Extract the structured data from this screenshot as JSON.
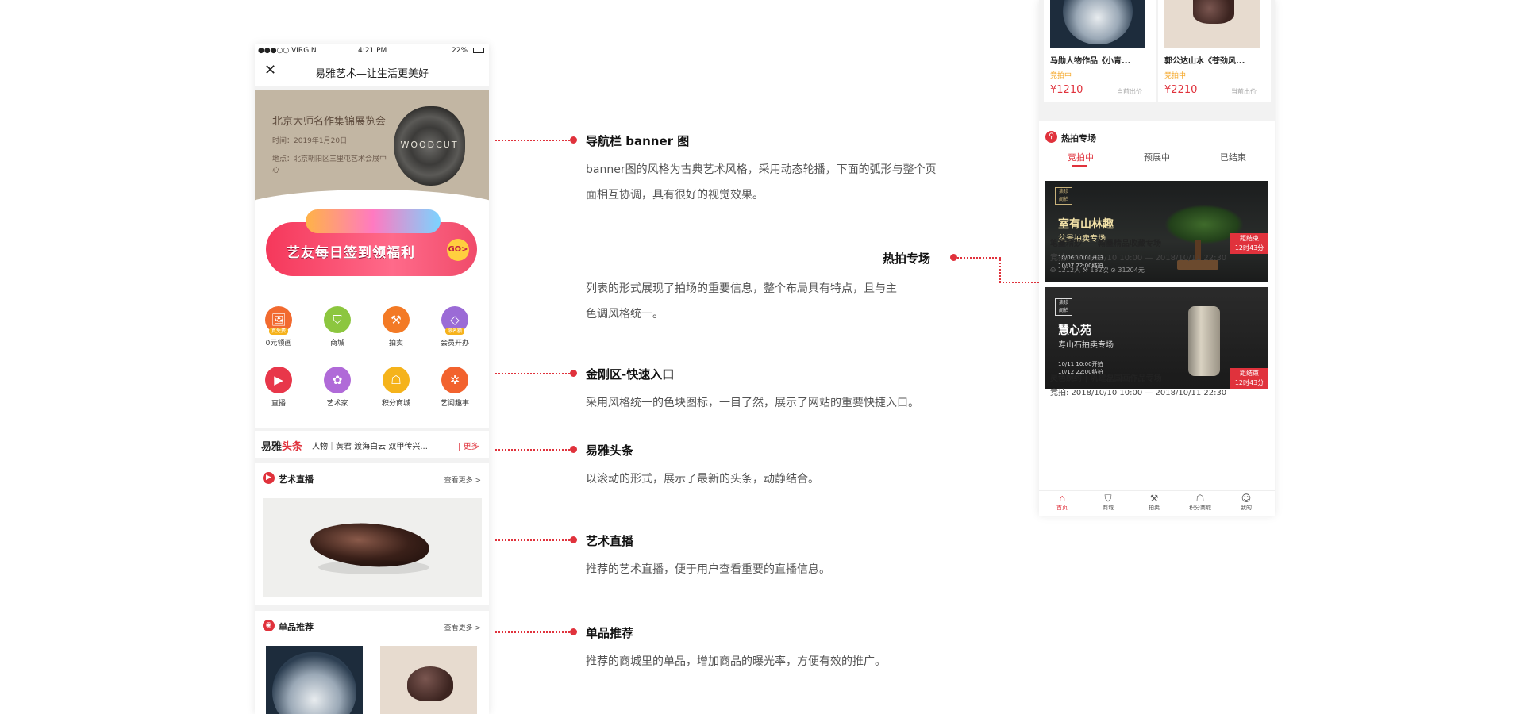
{
  "status": {
    "carrier": "●●●○○ VIRGIN",
    "time": "4:21 PM",
    "battery": "22%"
  },
  "nav": {
    "title": "易雅艺术—让生活更美好"
  },
  "banner": {
    "title": "北京大师名作集锦展览会",
    "time": "时间：2019年1月20日",
    "address": "地点：北京朝阳区三里屯艺术会展中心",
    "overlay": "WOODCUT"
  },
  "promo": {
    "text": "艺友每日签到领福利",
    "go": "GO>"
  },
  "grid": [
    {
      "label": "0元领画",
      "badge": "真免费",
      "color": "#f26a2f",
      "icon": "gift-icon",
      "glyph": "🖼"
    },
    {
      "label": "商城",
      "badge": "",
      "color": "#8cc63f",
      "icon": "bag-icon",
      "glyph": "⛉"
    },
    {
      "label": "拍卖",
      "badge": "",
      "color": "#f37a25",
      "icon": "gavel-icon",
      "glyph": "⚒"
    },
    {
      "label": "会员开办",
      "badge": "限名额",
      "color": "#9b6bd6",
      "icon": "diamond-icon",
      "glyph": "◇"
    },
    {
      "label": "直播",
      "badge": "",
      "color": "#e8374a",
      "icon": "tv-icon",
      "glyph": "▶"
    },
    {
      "label": "艺术家",
      "badge": "",
      "color": "#b06ad8",
      "icon": "palette-icon",
      "glyph": "✿"
    },
    {
      "label": "积分商城",
      "badge": "",
      "color": "#f5b31b",
      "icon": "basket-icon",
      "glyph": "☖"
    },
    {
      "label": "艺闻趣事",
      "badge": "",
      "color": "#f2622e",
      "icon": "pinwheel-icon",
      "glyph": "✲"
    }
  ],
  "headline": {
    "brand_black": "易雅",
    "brand_red": "头条",
    "text": "人物｜黄君   渡海白云  双甲传兴...",
    "more": "| 更多"
  },
  "live": {
    "title": "艺术直播",
    "more": "查看更多 >"
  },
  "single": {
    "title": "单品推荐",
    "more": "查看更多 >"
  },
  "annotations": [
    {
      "title": "导航栏 banner 图",
      "lines": [
        "banner图的风格为古典艺术风格，采用动态轮播，下面的弧形与整个页",
        "面相互协调，具有很好的视觉效果。"
      ]
    },
    {
      "title": "热拍专场",
      "lines": [
        "列表的形式展现了拍场的重要信息，整个布局具有特点，且与主",
        "色调风格统一。"
      ]
    },
    {
      "title": "金刚区-快速入口",
      "lines": [
        "采用风格统一的色块图标，一目了然，展示了网站的重要快捷入口。"
      ]
    },
    {
      "title": "易雅头条",
      "lines": [
        "以滚动的形式，展示了最新的头条，动静结合。"
      ]
    },
    {
      "title": "艺术直播",
      "lines": [
        "推荐的艺术直播，便于用户查看重要的直播信息。"
      ]
    },
    {
      "title": "单品推荐",
      "lines": [
        "推荐的商城里的单品，增加商品的曝光率，方便有效的推广。"
      ]
    }
  ],
  "products": [
    {
      "name": "马勋人物作品《小青...",
      "status": "竞拍中",
      "price": "¥1210",
      "note": "当前出价"
    },
    {
      "name": "郭公达山水《苍劲风...",
      "status": "竞拍中",
      "price": "¥2210",
      "note": "当前出价"
    }
  ],
  "hot": {
    "title": "热拍专场",
    "tabs": [
      "竞拍中",
      "预展中",
      "已结束"
    ]
  },
  "auctions": [
    {
      "img_title": "室有山林趣",
      "img_sub": "盆景拍卖专场",
      "img_dates": "10/06 10:00开拍\n10/07 22:00结拍",
      "end": "距结束\n12时43分",
      "title": "笔墨精妙——翰墨精品收藏专场",
      "time": "竞拍: 2018/10/10 10:00 — 2018/10/11 22:30",
      "stats": "⚇ 1212人     ⚒ 132次     ⊙ 31204元"
    },
    {
      "img_title": "慧心苑",
      "img_sub": "寿山石拍卖专场",
      "img_dates": "10/11 10:00开拍\n10/12 22:00结拍",
      "end": "距结束\n12时43分",
      "title": "灵色婉约 | 巩建磊国画作品专场",
      "time": "竞拍: 2018/10/10 10:00 — 2018/10/11 22:30",
      "stats": ""
    }
  ],
  "tabbar": [
    {
      "label": "首页",
      "icon": "home-icon",
      "glyph": "⌂"
    },
    {
      "label": "商城",
      "icon": "bag-icon",
      "glyph": "⛉"
    },
    {
      "label": "拍卖",
      "icon": "gavel-icon",
      "glyph": "⚒"
    },
    {
      "label": "积分商城",
      "icon": "basket-icon",
      "glyph": "☖"
    },
    {
      "label": "我的",
      "icon": "person-icon",
      "glyph": "☺"
    }
  ]
}
